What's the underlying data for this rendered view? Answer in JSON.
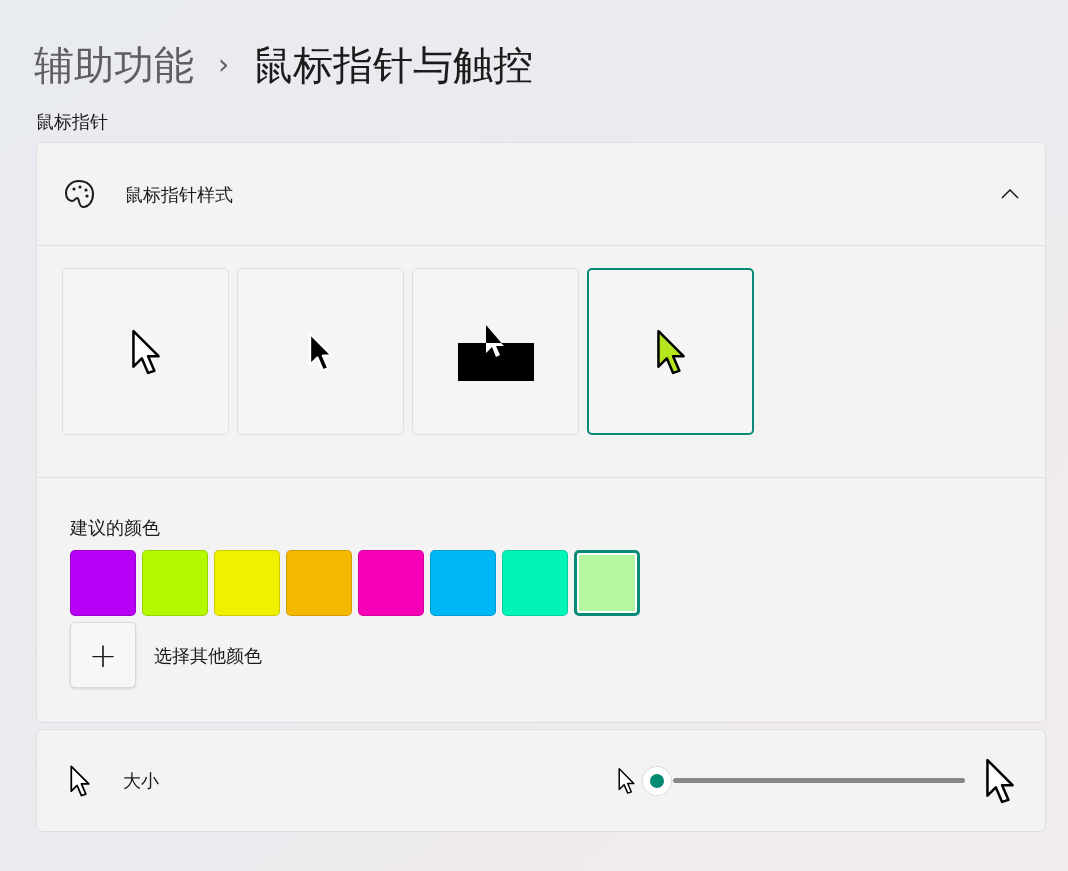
{
  "breadcrumb": {
    "parent": "辅助功能",
    "separator": "›",
    "current": "鼠标指针与触控"
  },
  "section_label": "鼠标指针",
  "pointer_style": {
    "title": "鼠标指针样式",
    "expanded": true,
    "styles": [
      {
        "kind": "white",
        "selected": false
      },
      {
        "kind": "black",
        "selected": false
      },
      {
        "kind": "inverted",
        "selected": false
      },
      {
        "kind": "custom",
        "selected": true
      }
    ],
    "suggested_label": "建议的颜色",
    "colors": [
      {
        "color": "#b700f5",
        "selected": false
      },
      {
        "color": "#b5f900",
        "selected": false
      },
      {
        "color": "#f0f000",
        "selected": false
      },
      {
        "color": "#f5b800",
        "selected": false
      },
      {
        "color": "#f700b7",
        "selected": false
      },
      {
        "color": "#00b7f5",
        "selected": false
      },
      {
        "color": "#00f5b7",
        "selected": false
      },
      {
        "color": "#b5f7a0",
        "selected": true
      }
    ],
    "add_symbol": "+",
    "add_label": "选择其他颜色"
  },
  "size": {
    "label": "大小",
    "level": 0
  }
}
